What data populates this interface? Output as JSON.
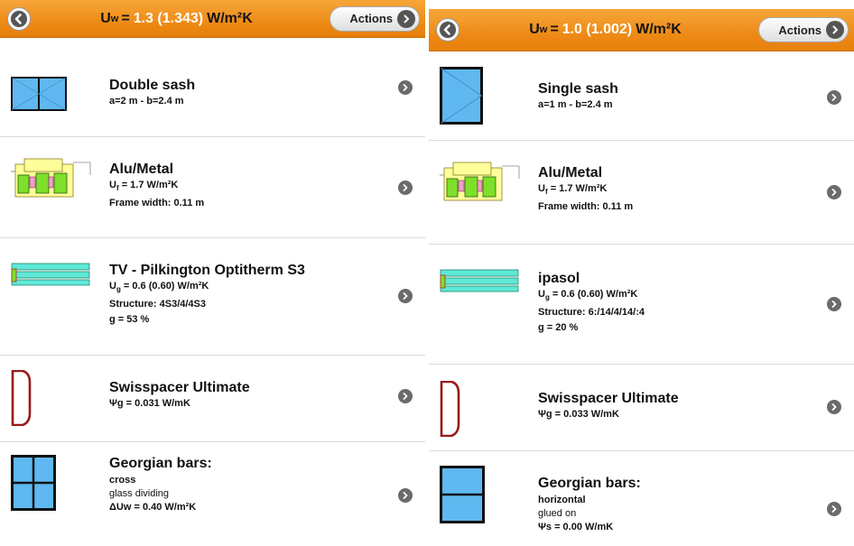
{
  "left": {
    "header": {
      "uw_symbol": "U",
      "uw_sub": "w",
      "uw_equals": "=",
      "uw_value": "1.3 (1.343)",
      "uw_unit": "W/m²K",
      "actions_label": "Actions"
    },
    "rows": [
      {
        "title": "Double sash",
        "lines": [
          "a=2 m - b=2.4 m"
        ]
      },
      {
        "title": "Alu/Metal",
        "u_symbol": "U",
        "u_sub": "f",
        "u_value": "= 1.7 W/m²K",
        "lines": [
          "Frame width: 0.11 m"
        ]
      },
      {
        "title": "TV - Pilkington Optitherm S3",
        "u_symbol": "U",
        "u_sub": "g",
        "u_value": "= 0.6 (0.60) W/m²K",
        "lines": [
          "Structure: 4S3/4/4S3",
          "g = 53 %"
        ]
      },
      {
        "title": "Swisspacer Ultimate",
        "lines": [
          "Ψg = 0.031 W/mK"
        ]
      },
      {
        "title": "Georgian bars:",
        "lines": [
          "cross",
          "glass dividing",
          "ΔUw = 0.40 W/m²K"
        ]
      }
    ]
  },
  "right": {
    "header": {
      "uw_symbol": "U",
      "uw_sub": "w",
      "uw_equals": "=",
      "uw_value": "1.0 (1.002)",
      "uw_unit": "W/m²K",
      "actions_label": "Actions"
    },
    "rows": [
      {
        "title": "Single sash",
        "lines": [
          "a=1 m - b=2.4 m"
        ]
      },
      {
        "title": "Alu/Metal",
        "u_symbol": "U",
        "u_sub": "f",
        "u_value": "= 1.7 W/m²K",
        "lines": [
          "Frame width: 0.11 m"
        ]
      },
      {
        "title": "ipasol",
        "u_symbol": "U",
        "u_sub": "g",
        "u_value": "= 0.6 (0.60) W/m²K",
        "lines": [
          "Structure: 6:/14/4/14/:4",
          "g = 20 %"
        ]
      },
      {
        "title": "Swisspacer Ultimate",
        "lines": [
          "Ψg = 0.033 W/mK"
        ]
      },
      {
        "title": "Georgian bars:",
        "lines": [
          "horizontal",
          "glued on",
          "Ψs = 0.00 W/mK"
        ]
      }
    ]
  },
  "colors": {
    "header_orange": "#ec8712",
    "glass_blue": "#5fb8f0",
    "profile_green": "#7ee02a",
    "profile_yellow": "#ffff9a",
    "pane_cyan": "#5fe8d8",
    "spacer_red": "#9a1a1a"
  },
  "icons": [
    "back-icon",
    "chevron-right-icon",
    "double-sash-icon",
    "single-sash-icon",
    "frame-profile-icon",
    "glazing-icon",
    "spacer-icon",
    "georgian-cross-icon",
    "georgian-horizontal-icon"
  ]
}
